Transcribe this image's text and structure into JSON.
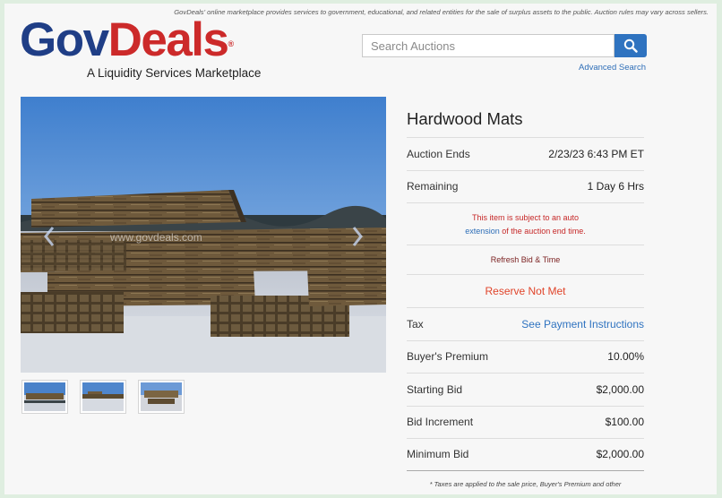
{
  "header": {
    "disclaimer": "GovDeals' online marketplace provides services to government, educational, and related entities for the sale of surplus assets to the public. Auction rules may vary across sellers.",
    "logo_gov": "Gov",
    "logo_deals": "Deals",
    "logo_reg": "®",
    "tagline": "A Liquidity Services Marketplace"
  },
  "search": {
    "placeholder": "Search Auctions",
    "advanced_label": "Advanced Search"
  },
  "gallery": {
    "watermark": "www.govdeals.com",
    "thumbnails": [
      "thumbnail-1",
      "thumbnail-2",
      "thumbnail-3"
    ]
  },
  "item": {
    "title": "Hardwood Mats",
    "auction_ends_label": "Auction Ends",
    "auction_ends_value": "2/23/23 6:43 PM ET",
    "remaining_label": "Remaining",
    "remaining_value": "1 Day 6 Hrs",
    "notice_line1": "This item is subject to an auto",
    "notice_link": "extension",
    "notice_line2": " of the auction end time.",
    "refresh_label": "Refresh Bid & Time",
    "reserve_status": "Reserve Not Met",
    "tax_label": "Tax",
    "tax_link": "See Payment Instructions",
    "buyers_premium_label": "Buyer's Premium",
    "buyers_premium_value": "10.00%",
    "starting_bid_label": "Starting Bid",
    "starting_bid_value": "$2,000.00",
    "bid_increment_label": "Bid Increment",
    "bid_increment_value": "$100.00",
    "minimum_bid_label": "Minimum Bid",
    "minimum_bid_value": "$2,000.00",
    "footnote": "* Taxes are applied to the sale price, Buyer's Premium and other"
  },
  "colors": {
    "brand_blue": "#1f3e86",
    "brand_red": "#cc2a2a",
    "link_blue": "#2f73c0",
    "reserve_red": "#e0442a"
  },
  "icons": {
    "search": "search-icon",
    "prev": "chevron-left-icon",
    "next": "chevron-right-icon"
  }
}
